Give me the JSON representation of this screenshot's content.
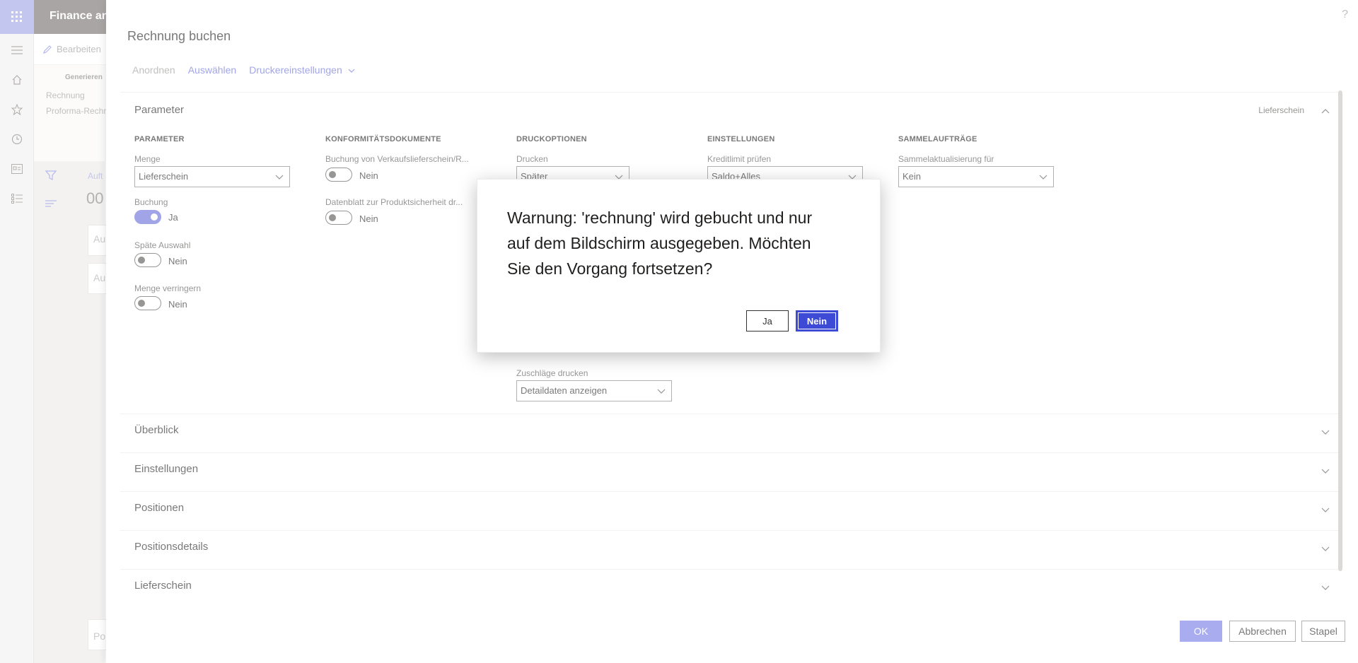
{
  "app": {
    "title": "Finance and"
  },
  "background": {
    "edit_label": "Bearbeiten",
    "group_label": "Generieren",
    "links": [
      "Rechnung",
      "Proforma-Rechn"
    ],
    "frag1": "Auft",
    "frag2": "00",
    "frag3": "Au",
    "frag4": "Au",
    "frag5": "Po"
  },
  "panel": {
    "title": "Rechnung buchen",
    "toolbar": {
      "arrange": "Anordnen",
      "select": "Auswählen",
      "printer": "Druckereinstellungen"
    }
  },
  "parameters": {
    "tab_title": "Parameter",
    "tab_summary": "Lieferschein",
    "col1": {
      "heading": "PARAMETER",
      "menge_label": "Menge",
      "menge_value": "Lieferschein",
      "buchung_label": "Buchung",
      "buchung_value": "Ja",
      "spaete_label": "Späte Auswahl",
      "spaete_value": "Nein",
      "verringern_label": "Menge verringern",
      "verringern_value": "Nein"
    },
    "col2": {
      "heading": "KONFORMITÄTSDOKUMENTE",
      "buchung_verkauf_label": "Buchung von Verkaufslieferschein/R...",
      "buchung_verkauf_value": "Nein",
      "datenblatt_label": "Datenblatt zur Produktsicherheit dr...",
      "datenblatt_value": "Nein"
    },
    "col3": {
      "heading": "DRUCKOPTIONEN",
      "drucken_label": "Drucken",
      "drucken_value": "Später",
      "zuschlaege_label": "Zuschläge drucken",
      "zuschlaege_value": "Detaildaten anzeigen"
    },
    "col4": {
      "heading": "EINSTELLUNGEN",
      "kredit_label": "Kreditlimit prüfen",
      "kredit_value": "Saldo+Alles"
    },
    "col5": {
      "heading": "SAMMELAUFTRÄGE",
      "sammel_label": "Sammelaktualisierung für",
      "sammel_value": "Kein"
    }
  },
  "fasttabs": [
    "Überblick",
    "Einstellungen",
    "Positionen",
    "Positionsdetails",
    "Lieferschein"
  ],
  "footer": {
    "ok": "OK",
    "cancel": "Abbrechen",
    "batch": "Stapel"
  },
  "dialog": {
    "message": "Warnung: 'rechnung' wird gebucht und nur auf dem Bildschirm ausgegeben. Möchten Sie den Vorgang fortsetzen?",
    "yes": "Ja",
    "no": "Nein"
  },
  "colors": {
    "accent": "#6f75dc",
    "dialog_primary": "#3d4ad6",
    "footer_primary": "#7b81e6"
  }
}
